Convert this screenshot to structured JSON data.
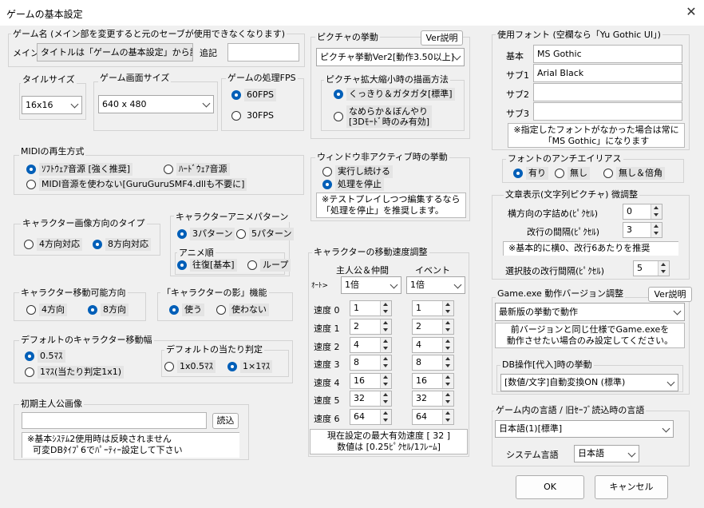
{
  "window": {
    "title": "ゲームの基本設定"
  },
  "game_name": {
    "group": "ゲーム名 (メイン部を変更すると元のセーブが使用できなくなります)",
    "main_label": "メイン",
    "main_value": "タイトルは「ゲームの基本設定」から設",
    "append_label": "追記",
    "append_value": ""
  },
  "tile_size": {
    "group": "タイルサイズ",
    "value": "16x16"
  },
  "screen_size": {
    "group": "ゲーム画面サイズ",
    "value": "640 x 480"
  },
  "fps": {
    "group": "ゲームの処理FPS",
    "opt1": "60FPS",
    "opt2": "30FPS",
    "selected": "60FPS"
  },
  "midi": {
    "group": "MIDIの再生方式",
    "opt1": "ｿﾌﾄｳｪｱ音源 [強く推奨]",
    "opt2": "ﾊｰﾄﾞｳｪｱ音源",
    "opt3": "MIDI音源を使わない[GuruGuruSMF4.dllも不要に]",
    "selected": "ｿﾌﾄｳｪｱ音源 [強く推奨]"
  },
  "char_dir": {
    "group": "キャラクター画像方向のタイプ",
    "opt1": "4方向対応",
    "opt2": "8方向対応",
    "selected": "8方向対応"
  },
  "char_anim": {
    "group": "キャラクターアニメパターン",
    "opt1": "3パターン",
    "opt2": "5パターン",
    "selected": "3パターン",
    "order_group": "アニメ順",
    "order1": "往復[基本]",
    "order2": "ループ",
    "order_selected": "往復[基本]"
  },
  "move_dir": {
    "group": "キャラクター移動可能方向",
    "opt1": "4方向",
    "opt2": "8方向",
    "selected": "8方向"
  },
  "shadow": {
    "group": "「キャラクターの影」機能",
    "opt1": "使う",
    "opt2": "使わない",
    "selected": "使う"
  },
  "move_width": {
    "group": "デフォルトのキャラクター移動幅",
    "opt1": "0.5ﾏｽ",
    "opt2": "1ﾏｽ(当たり判定1x1)",
    "selected": "0.5ﾏｽ",
    "hit_group": "デフォルトの当たり判定",
    "hit1": "1x0.5ﾏｽ",
    "hit2": "1×1ﾏｽ",
    "hit_selected": "1×1ﾏｽ"
  },
  "initial_hero": {
    "group": "初期主人公画像",
    "value": "",
    "load": "読込",
    "note": "※基本ｼｽﾃﾑ2使用時は反映されません\n  可変DBﾀｲﾌﾟ6でﾊﾟｰﾃｨｰ設定して下さい"
  },
  "picture": {
    "group": "ピクチャの挙動",
    "ver_button": "Ver説明",
    "value": "ピクチャ挙動Ver2[動作3.50以上]",
    "scale_group": "ピクチャ拡大縮小時の描画方法",
    "scale1": "くっきり＆ガタガタ[標準]",
    "scale2": "なめらか＆ぼんやり\n[3Dﾓｰﾄﾞ時のみ有効]",
    "scale_selected": "くっきり＆ガタガタ[標準]"
  },
  "inactive": {
    "group": "ウィンドウ非アクティブ時の挙動",
    "opt1": "実行し続ける",
    "opt2": "処理を停止",
    "selected": "処理を停止",
    "note": "※テストプレイしつつ編集するなら\n「処理を停止」を推奨します。"
  },
  "speed": {
    "group": "キャラクターの移動速度調整",
    "hero_header": "主人公＆仲間",
    "event_header": "イベント",
    "auto_label": "ｵｰﾄ>",
    "hero_auto": "1倍",
    "event_auto": "1倍",
    "rows": [
      {
        "label": "速度 0",
        "hero": "1",
        "event": "1"
      },
      {
        "label": "速度 1",
        "hero": "2",
        "event": "2"
      },
      {
        "label": "速度 2",
        "hero": "4",
        "event": "4"
      },
      {
        "label": "速度 3",
        "hero": "8",
        "event": "8"
      },
      {
        "label": "速度 4",
        "hero": "16",
        "event": "16"
      },
      {
        "label": "速度 5",
        "hero": "32",
        "event": "32"
      },
      {
        "label": "速度 6",
        "hero": "64",
        "event": "64"
      }
    ],
    "note": "現在設定の最大有効速度 [ 32 ]\n数値は [0.25ﾋﾟｸｾﾙ/1ﾌﾚｰﾑ]"
  },
  "fonts": {
    "group": "使用フォント (空欄なら「Yu Gothic UI」)",
    "main_label": "基本",
    "main": "MS Gothic",
    "sub1_label": "サブ1",
    "sub1": "Arial Black",
    "sub2_label": "サブ2",
    "sub2": "",
    "sub3_label": "サブ3",
    "sub3": "",
    "note": "※指定したフォントがなかった場合は常に\n「MS Gothic」になります"
  },
  "antialias": {
    "group": "フォントのアンチエイリアス",
    "opt1": "有り",
    "opt2": "無し",
    "opt3": "無し＆倍角",
    "selected": "有り"
  },
  "text_display": {
    "group": "文章表示(文字列ピクチャ) 微調整",
    "h_spacing_label": "横方向の字詰め(ﾋﾟｸｾﾙ)",
    "h_spacing": "0",
    "line_spacing_label": "改行の間隔(ﾋﾟｸｾﾙ)",
    "line_spacing": "3",
    "note": "※基本的に横0、改行6あたりを推奨",
    "choice_label": "選択肢の改行間隔(ﾋﾟｸｾﾙ)",
    "choice": "5"
  },
  "version": {
    "group": "Game.exe 動作バージョン調整",
    "ver_button": "Ver説明",
    "value": "最新版の挙動で動作",
    "note": "前バージョンと同じ仕様でGame.exeを\n動作させたい場合のみ設定してください。",
    "db_group": "DB操作[代入]時の挙動",
    "db_value": "[数値/文字]自動変換ON (標準)"
  },
  "language": {
    "group": "ゲーム内の言語 / 旧ｾｰﾌﾞ読込時の言語",
    "value": "日本語(1)[標準]",
    "system_label": "システム言語",
    "system_value": "日本語"
  },
  "buttons": {
    "ok": "OK",
    "cancel": "キャンセル"
  }
}
